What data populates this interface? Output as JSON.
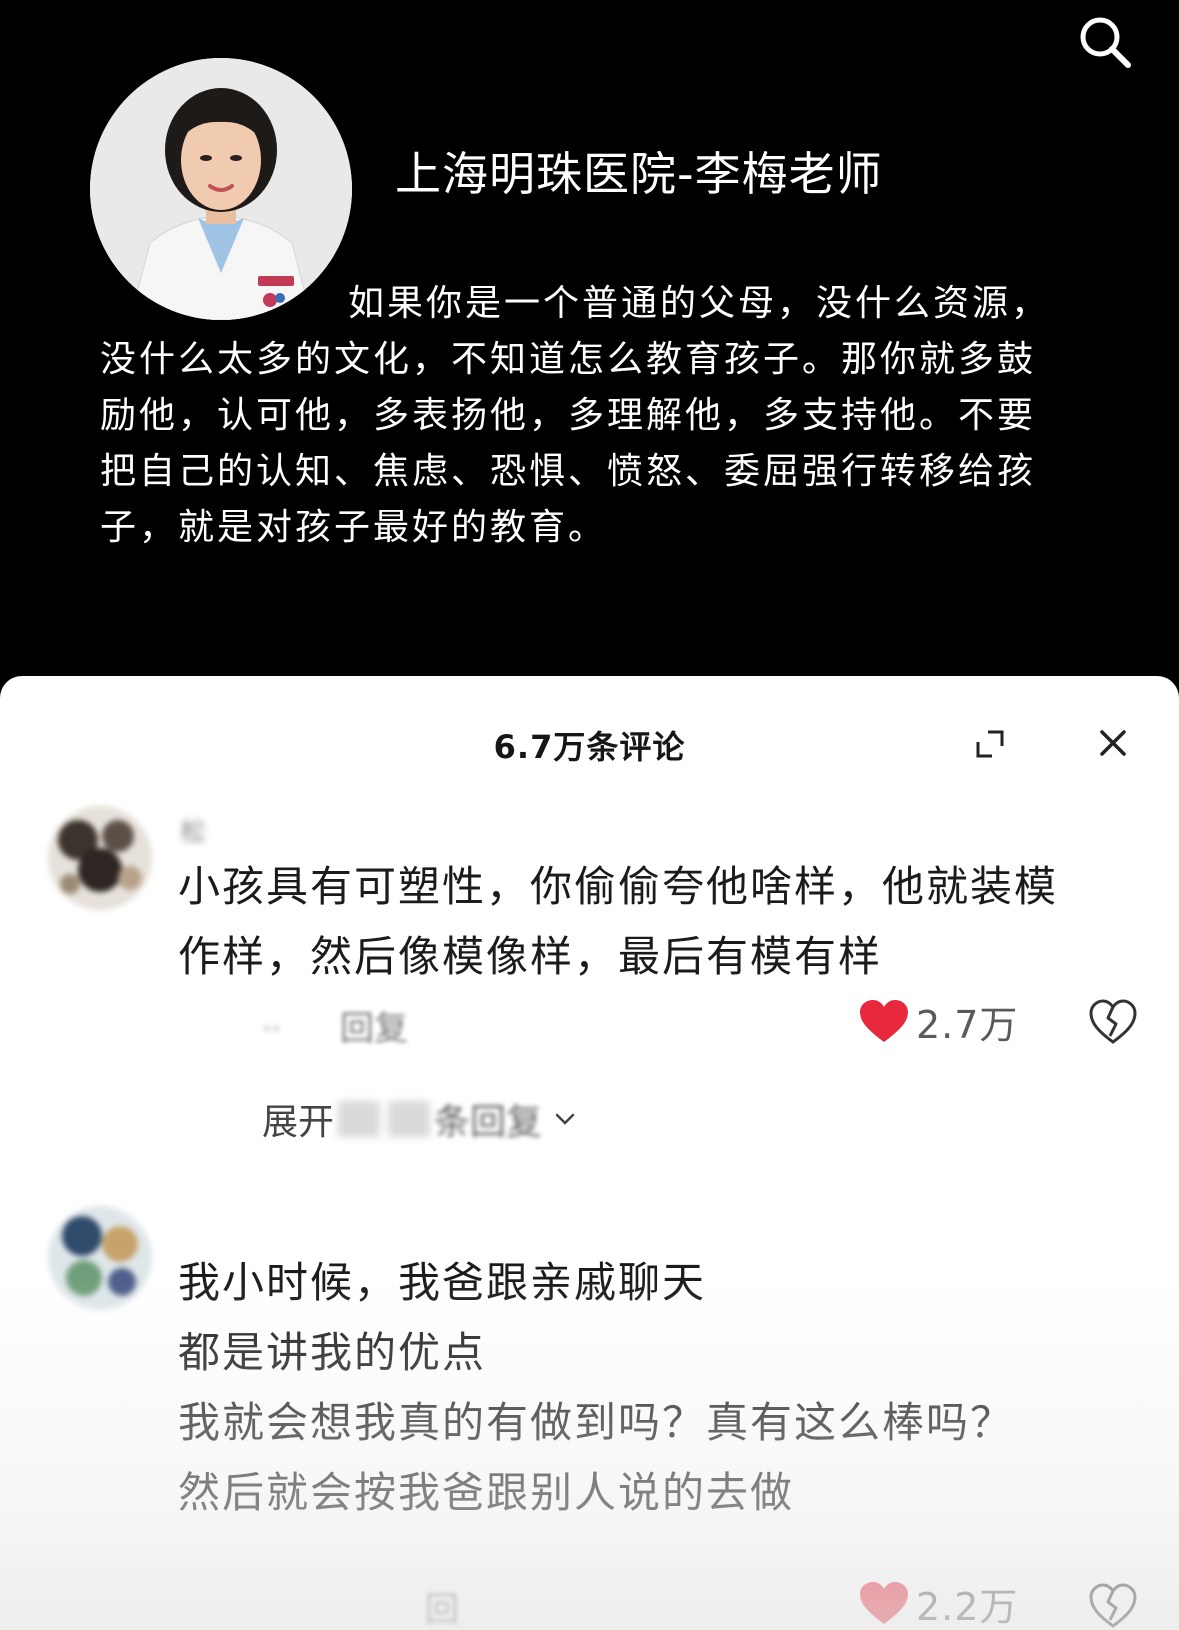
{
  "header": {
    "speaker_title": "上海明珠医院-李梅老师",
    "quote_first_line": "如果你是一个普通的父母，没什么资源，",
    "quote_lines": [
      "没什么太多的文化，不知道怎么教育孩子。那你就多鼓",
      "励他，认可他，多表扬他，多理解他，多支持他。不要",
      "把自己的认知、焦虑、恐惧、愤怒、委屈强行转移给孩",
      "子，就是对孩子最好的教育。"
    ]
  },
  "comments_panel": {
    "title": "6.7万条评论",
    "comments": [
      {
        "author": "松",
        "body_lines": [
          "小孩具有可塑性，你偷偷夸他啥样，他就装模",
          "作样，然后像模像样，最后有模有样"
        ],
        "reply_label": "回复",
        "likes": "2.7万",
        "expand_replies": {
          "prefix": "展开",
          "suffix": "条回复"
        }
      },
      {
        "author": "",
        "body_lines": [
          "我小时候，我爸跟亲戚聊天",
          "都是讲我的优点",
          "我就会想我真的有做到吗？真有这么棒吗？",
          "然后就会按我爸跟别人说的去做"
        ],
        "reply_label": "回",
        "likes": "2.2万"
      }
    ]
  },
  "icons": {
    "search": "search-icon",
    "expand": "expand-icon",
    "close": "close-icon",
    "like": "heart-icon",
    "dislike": "broken-heart-icon",
    "chevron": "chevron-down-icon"
  },
  "colors": {
    "background_top": "#000000",
    "sheet": "#ffffff",
    "like_red": "#e8293d",
    "text_dark": "#1b1b1b"
  }
}
